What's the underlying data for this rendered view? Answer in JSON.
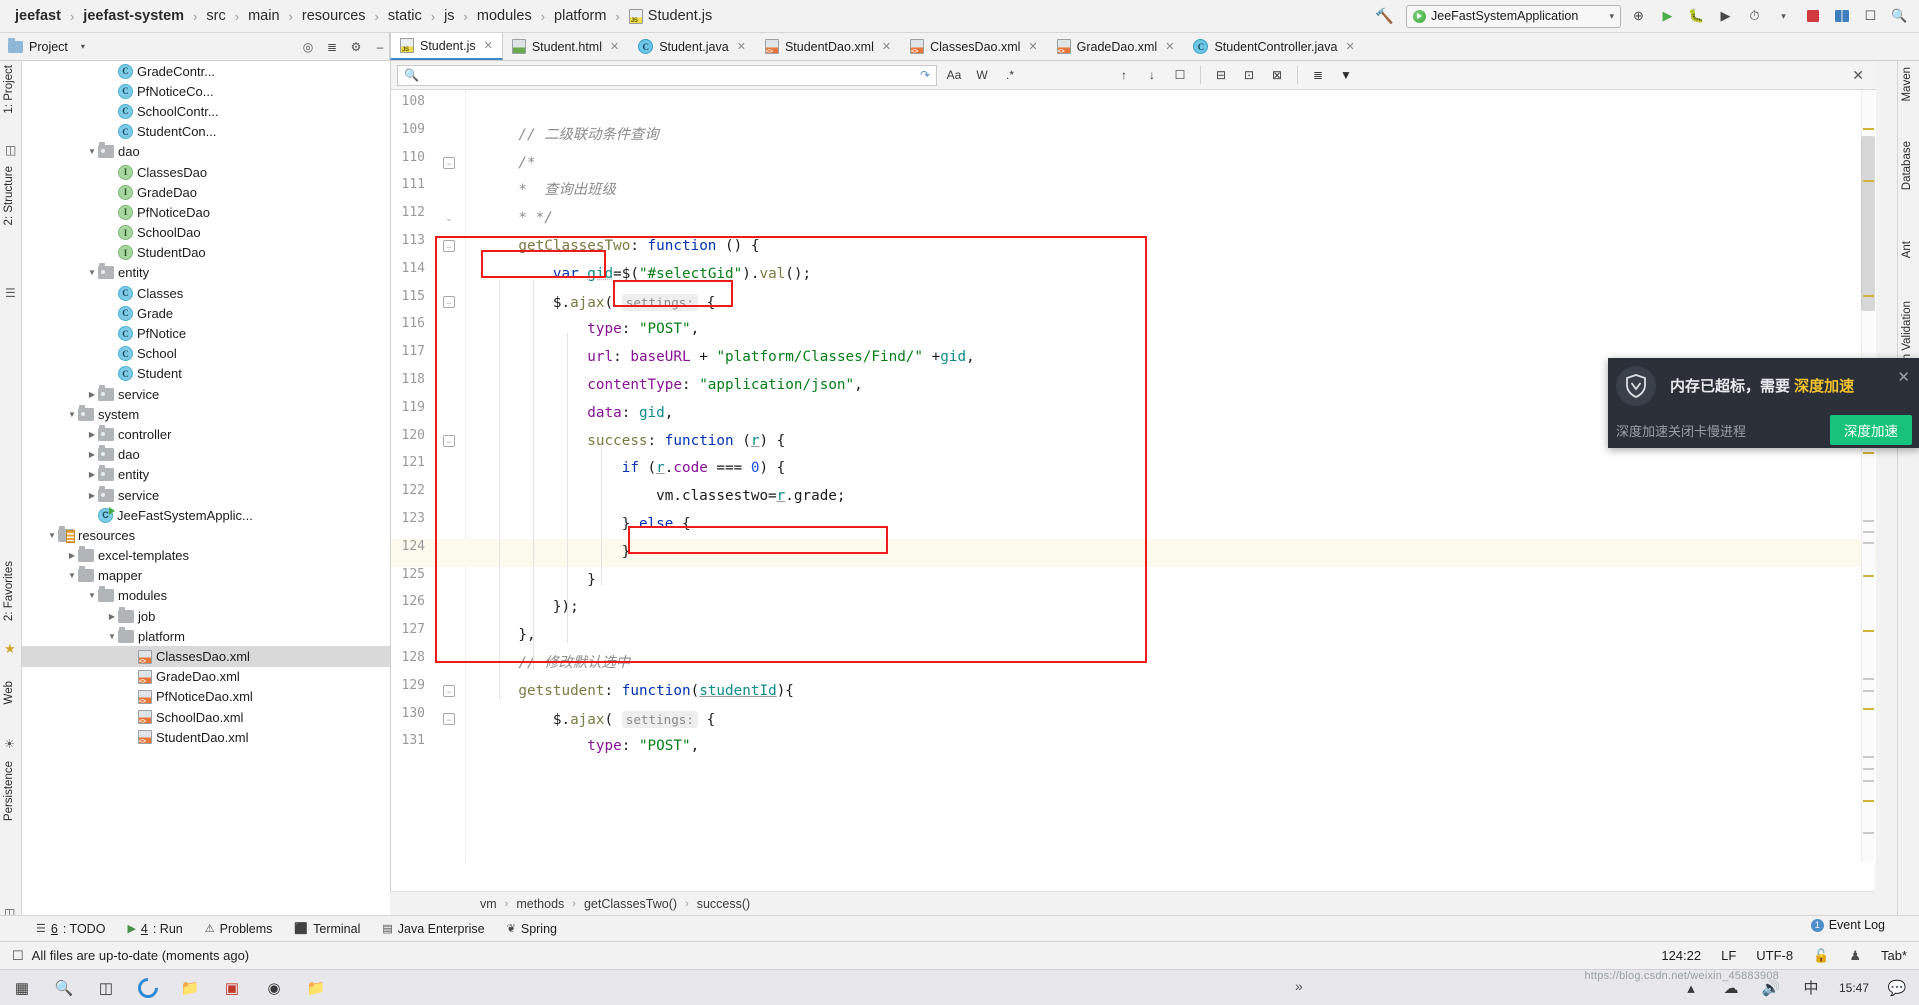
{
  "breadcrumb": {
    "items": [
      "jeefast",
      "jeefast-system",
      "src",
      "main",
      "resources",
      "static",
      "js",
      "modules",
      "platform"
    ],
    "file": "Student.js"
  },
  "toolbar": {
    "hammer_icon": "hammer-icon",
    "run_config": "JeeFastSystemApplication",
    "caret": "▾",
    "run_icon": "run-icon",
    "debug_icon": "debug-icon",
    "coverage_icon": "coverage-icon",
    "profile_icon": "profile-icon",
    "stop_icon": "stop-icon",
    "layout_icon": "layout-icon",
    "updates_icon": "updates-icon",
    "search_icon": "search-icon"
  },
  "project_panel": {
    "title": "Project",
    "collapse_icon": "chevron-down-icon",
    "locate_icon": "locate-icon",
    "collapse_all_icon": "collapse-all-icon",
    "settings_icon": "gear-icon",
    "hide_icon": "minimize-icon"
  },
  "tabs": [
    {
      "label": "Student.js",
      "icon": "js-file-icon",
      "active": true
    },
    {
      "label": "Student.html",
      "icon": "html-file-icon",
      "active": false
    },
    {
      "label": "Student.java",
      "icon": "java-file-icon",
      "active": false
    },
    {
      "label": "StudentDao.xml",
      "icon": "xml-file-icon",
      "active": false
    },
    {
      "label": "ClassesDao.xml",
      "icon": "xml-file-icon",
      "active": false
    },
    {
      "label": "GradeDao.xml",
      "icon": "xml-file-icon",
      "active": false
    },
    {
      "label": "StudentController.java",
      "icon": "java-file-icon",
      "active": false
    }
  ],
  "left_rail": [
    "1: Project",
    "2: Structure",
    "2: Favorites",
    "Web",
    "Persistence"
  ],
  "right_rail": [
    "Maven",
    "Database",
    "Ant",
    "Bean Validation"
  ],
  "tree": [
    {
      "indent": 4,
      "icon": "class-icon",
      "label": "GradeContr...",
      "selected": false
    },
    {
      "indent": 4,
      "icon": "class-icon",
      "label": "PfNoticeCo...",
      "selected": false
    },
    {
      "indent": 4,
      "icon": "class-icon",
      "label": "SchoolContr...",
      "selected": false
    },
    {
      "indent": 4,
      "icon": "class-icon",
      "label": "StudentCon...",
      "selected": false
    },
    {
      "indent": 3,
      "icon": "folder-icon",
      "label": "dao",
      "arrow": "▼",
      "selected": false
    },
    {
      "indent": 4,
      "icon": "interface-icon",
      "label": "ClassesDao",
      "selected": false
    },
    {
      "indent": 4,
      "icon": "interface-icon",
      "label": "GradeDao",
      "selected": false
    },
    {
      "indent": 4,
      "icon": "interface-icon",
      "label": "PfNoticeDao",
      "selected": false
    },
    {
      "indent": 4,
      "icon": "interface-icon",
      "label": "SchoolDao",
      "selected": false
    },
    {
      "indent": 4,
      "icon": "interface-icon",
      "label": "StudentDao",
      "selected": false
    },
    {
      "indent": 3,
      "icon": "folder-icon",
      "label": "entity",
      "arrow": "▼",
      "selected": false
    },
    {
      "indent": 4,
      "icon": "class-icon",
      "label": "Classes",
      "selected": false
    },
    {
      "indent": 4,
      "icon": "class-icon",
      "label": "Grade",
      "selected": false
    },
    {
      "indent": 4,
      "icon": "class-icon",
      "label": "PfNotice",
      "selected": false
    },
    {
      "indent": 4,
      "icon": "class-icon",
      "label": "School",
      "selected": false
    },
    {
      "indent": 4,
      "icon": "class-icon",
      "label": "Student",
      "selected": false
    },
    {
      "indent": 3,
      "icon": "folder-icon",
      "label": "service",
      "arrow": "▶",
      "selected": false
    },
    {
      "indent": 2,
      "icon": "folder-icon",
      "label": "system",
      "arrow": "▼",
      "selected": false
    },
    {
      "indent": 3,
      "icon": "folder-icon",
      "label": "controller",
      "arrow": "▶",
      "selected": false
    },
    {
      "indent": 3,
      "icon": "folder-icon",
      "label": "dao",
      "arrow": "▶",
      "selected": false
    },
    {
      "indent": 3,
      "icon": "folder-icon",
      "label": "entity",
      "arrow": "▶",
      "selected": false
    },
    {
      "indent": 3,
      "icon": "folder-icon",
      "label": "service",
      "arrow": "▶",
      "selected": false
    },
    {
      "indent": 3,
      "icon": "app-class-icon",
      "label": "JeeFastSystemApplic...",
      "selected": false
    },
    {
      "indent": 1,
      "icon": "resources-icon",
      "label": "resources",
      "arrow": "▼",
      "selected": false
    },
    {
      "indent": 2,
      "icon": "folder-plain-icon",
      "label": "excel-templates",
      "arrow": "▶",
      "selected": false
    },
    {
      "indent": 2,
      "icon": "folder-plain-icon",
      "label": "mapper",
      "arrow": "▼",
      "selected": false
    },
    {
      "indent": 3,
      "icon": "folder-plain-icon",
      "label": "modules",
      "arrow": "▼",
      "selected": false
    },
    {
      "indent": 4,
      "icon": "folder-plain-icon",
      "label": "job",
      "arrow": "▶",
      "selected": false
    },
    {
      "indent": 4,
      "icon": "folder-plain-icon",
      "label": "platform",
      "arrow": "▼",
      "selected": false
    },
    {
      "indent": 5,
      "icon": "xml-small-icon",
      "label": "ClassesDao.xml",
      "selected": true
    },
    {
      "indent": 5,
      "icon": "xml-small-icon",
      "label": "GradeDao.xml",
      "selected": false
    },
    {
      "indent": 5,
      "icon": "xml-small-icon",
      "label": "PfNoticeDao.xml",
      "selected": false
    },
    {
      "indent": 5,
      "icon": "xml-small-icon",
      "label": "SchoolDao.xml",
      "selected": false
    },
    {
      "indent": 5,
      "icon": "xml-small-icon",
      "label": "StudentDao.xml",
      "selected": false
    }
  ],
  "find_bar": {
    "placeholder": "",
    "value": "",
    "search_icon": "search-icon",
    "loop_icon": "loop-icon",
    "match_case_label": "Aa",
    "words_label": "W",
    "regex_label": ".*",
    "prev_icon": "arrow-up-icon",
    "next_icon": "arrow-down-icon",
    "select_all_icon": "select-all-icon",
    "filter_icon": "filter-icon",
    "close_icon": "close-icon"
  },
  "code": {
    "first_line": 108,
    "highlighted_line": 124,
    "lines": [
      {
        "n": 108,
        "fold": "",
        "tokens": []
      },
      {
        "n": 109,
        "fold": "",
        "tokens": [
          {
            "t": "cmt",
            "s": "    // 二级联动条件查询"
          }
        ]
      },
      {
        "n": 110,
        "fold": "minus",
        "tokens": [
          {
            "t": "cmt",
            "s": "    /*"
          }
        ]
      },
      {
        "n": 111,
        "fold": "",
        "tokens": [
          {
            "t": "cmt",
            "s": "    *  查询出班级"
          }
        ]
      },
      {
        "n": 112,
        "fold": "end",
        "tokens": [
          {
            "t": "cmt",
            "s": "    * */"
          }
        ]
      },
      {
        "n": 113,
        "fold": "minus",
        "tokens": [
          {
            "t": "fn",
            "s": "    getClassesTwo"
          },
          {
            "t": "plain",
            "s": ": "
          },
          {
            "t": "kw",
            "s": "function"
          },
          {
            "t": "plain",
            "s": " () {"
          }
        ]
      },
      {
        "n": 114,
        "fold": "",
        "tokens": [
          {
            "t": "kw",
            "s": "        var"
          },
          {
            "t": "plain",
            "s": " "
          },
          {
            "t": "var-wavy",
            "s": "gid"
          },
          {
            "t": "plain",
            "s": "=$("
          },
          {
            "t": "str",
            "s": "\"#selectGid\""
          },
          {
            "t": "plain",
            "s": ")."
          },
          {
            "t": "fn",
            "s": "val"
          },
          {
            "t": "plain",
            "s": "();"
          }
        ]
      },
      {
        "n": 115,
        "fold": "minus",
        "tokens": [
          {
            "t": "plain",
            "s": "        $."
          },
          {
            "t": "fn",
            "s": "ajax"
          },
          {
            "t": "plain",
            "s": "( "
          },
          {
            "t": "hint",
            "s": "settings:"
          },
          {
            "t": "plain",
            "s": " {"
          }
        ]
      },
      {
        "n": 116,
        "fold": "",
        "tokens": [
          {
            "t": "prop",
            "s": "            type"
          },
          {
            "t": "plain",
            "s": ": "
          },
          {
            "t": "str",
            "s": "\"POST\""
          },
          {
            "t": "plain",
            "s": ","
          }
        ]
      },
      {
        "n": 117,
        "fold": "",
        "tokens": [
          {
            "t": "prop",
            "s": "            url"
          },
          {
            "t": "plain",
            "s": ": "
          },
          {
            "t": "prop",
            "s": "baseURL"
          },
          {
            "t": "plain",
            "s": " + "
          },
          {
            "t": "str",
            "s": "\"platform/Classes/Find/\""
          },
          {
            "t": "plain",
            "s": " +"
          },
          {
            "t": "var",
            "s": "gid"
          },
          {
            "t": "plain",
            "s": ","
          }
        ]
      },
      {
        "n": 118,
        "fold": "",
        "tokens": [
          {
            "t": "prop",
            "s": "            contentType"
          },
          {
            "t": "plain",
            "s": ": "
          },
          {
            "t": "str",
            "s": "\"application/json\""
          },
          {
            "t": "plain",
            "s": ","
          }
        ]
      },
      {
        "n": 119,
        "fold": "",
        "tokens": [
          {
            "t": "prop",
            "s": "            data"
          },
          {
            "t": "plain",
            "s": ": "
          },
          {
            "t": "var",
            "s": "gid"
          },
          {
            "t": "plain",
            "s": ","
          }
        ]
      },
      {
        "n": 120,
        "fold": "minus",
        "tokens": [
          {
            "t": "fn",
            "s": "            success"
          },
          {
            "t": "plain",
            "s": ": "
          },
          {
            "t": "kw",
            "s": "function"
          },
          {
            "t": "plain",
            "s": " ("
          },
          {
            "t": "var-under",
            "s": "r"
          },
          {
            "t": "plain",
            "s": ") {"
          }
        ]
      },
      {
        "n": 121,
        "fold": "",
        "tokens": [
          {
            "t": "kw",
            "s": "                if"
          },
          {
            "t": "plain",
            "s": " ("
          },
          {
            "t": "var-under",
            "s": "r"
          },
          {
            "t": "plain",
            "s": "."
          },
          {
            "t": "prop",
            "s": "code"
          },
          {
            "t": "plain",
            "s": " === "
          },
          {
            "t": "num",
            "s": "0"
          },
          {
            "t": "plain",
            "s": ") {"
          }
        ]
      },
      {
        "n": 122,
        "fold": "",
        "tokens": [
          {
            "t": "plain",
            "s": "                    vm.classestwo="
          },
          {
            "t": "var-under",
            "s": "r"
          },
          {
            "t": "plain",
            "s": ".grade;"
          }
        ]
      },
      {
        "n": 123,
        "fold": "",
        "tokens": [
          {
            "t": "plain",
            "s": "                } "
          },
          {
            "t": "kw",
            "s": "else"
          },
          {
            "t": "plain",
            "s": " {"
          }
        ]
      },
      {
        "n": 124,
        "fold": "",
        "tokens": [
          {
            "t": "plain",
            "s": "                }"
          }
        ]
      },
      {
        "n": 125,
        "fold": "",
        "tokens": [
          {
            "t": "plain",
            "s": "            }"
          }
        ]
      },
      {
        "n": 126,
        "fold": "",
        "tokens": [
          {
            "t": "plain",
            "s": "        });"
          }
        ]
      },
      {
        "n": 127,
        "fold": "",
        "tokens": [
          {
            "t": "plain",
            "s": "    },"
          }
        ]
      },
      {
        "n": 128,
        "fold": "",
        "tokens": [
          {
            "t": "cmt",
            "s": "    // 修改默认选中"
          }
        ]
      },
      {
        "n": 129,
        "fold": "minus",
        "tokens": [
          {
            "t": "fn",
            "s": "    getstudent"
          },
          {
            "t": "plain",
            "s": ": "
          },
          {
            "t": "kw",
            "s": "function"
          },
          {
            "t": "plain",
            "s": "("
          },
          {
            "t": "var-under",
            "s": "studentId"
          },
          {
            "t": "plain",
            "s": "){"
          }
        ]
      },
      {
        "n": 130,
        "fold": "minus",
        "tokens": [
          {
            "t": "plain",
            "s": "        $."
          },
          {
            "t": "fn",
            "s": "ajax"
          },
          {
            "t": "plain",
            "s": "( "
          },
          {
            "t": "hint",
            "s": "settings:"
          },
          {
            "t": "plain",
            "s": " {"
          }
        ]
      },
      {
        "n": 131,
        "fold": "",
        "tokens": [
          {
            "t": "prop",
            "s": "            type"
          },
          {
            "t": "plain",
            "s": ": "
          },
          {
            "t": "str",
            "s": "\"POST\""
          },
          {
            "t": "plain",
            "s": ","
          }
        ]
      }
    ]
  },
  "editor_breadcrumb": [
    "vm",
    "methods",
    "getClassesTwo()",
    "success()"
  ],
  "bottom_tools": [
    {
      "key": "6",
      "label": ": TODO",
      "icon": "todo-icon"
    },
    {
      "key": "4",
      "label": ": Run",
      "icon": "run-icon"
    },
    {
      "key": "",
      "label": "Problems",
      "icon": "warning-icon"
    },
    {
      "key": "",
      "label": "Terminal",
      "icon": "terminal-icon"
    },
    {
      "key": "",
      "label": "Java Enterprise",
      "icon": "java-enterprise-icon"
    },
    {
      "key": "",
      "label": "Spring",
      "icon": "spring-icon"
    }
  ],
  "event_log": {
    "label": "Event Log",
    "badge": "1"
  },
  "status": {
    "message": "All files are up-to-date (moments ago)",
    "caret_position": "124:22",
    "line_separator": "LF",
    "encoding": "UTF-8",
    "lock_icon": "unlocked-icon",
    "inspection_icon": "hector-icon",
    "indent": "Tab*"
  },
  "notification": {
    "title_prefix": "内存已超标，需要 ",
    "title_highlight": "深度加速",
    "subtitle": "深度加速关闭卡慢进程",
    "button": "深度加速",
    "close_icon": "close-icon",
    "shield_icon": "shield-icon",
    "accent": "#17c37b",
    "highlight_color": "#f2c12e"
  },
  "taskbar": {
    "start_icon": "windows-start-icon",
    "search_icon": "search-icon",
    "taskview_icon": "task-view-icon",
    "items": [
      "edge-icon",
      "folder-icon",
      "idea-icon",
      "chrome-icon",
      "folder-yellow-icon"
    ],
    "overflow": "»",
    "clock": "15:47",
    "watermark": "https://blog.csdn.net/weixin_45883908"
  }
}
